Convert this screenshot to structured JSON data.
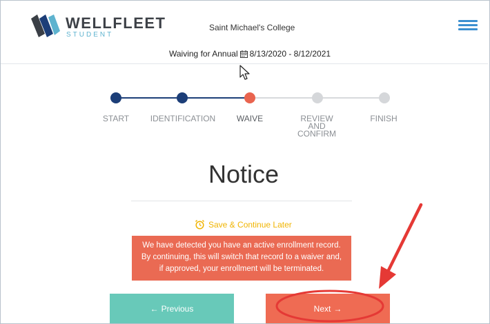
{
  "header": {
    "logo_word": "WELLFLEET",
    "logo_sub": "STUDENT",
    "college": "Saint Michael's College",
    "waive_prefix": "Waiving for Annual",
    "date_range": "8/13/2020 - 8/12/2021",
    "menu_icon": "hamburger-menu-icon"
  },
  "steps": [
    {
      "label": "START",
      "state": "done"
    },
    {
      "label": "IDENTIFICATION",
      "state": "done"
    },
    {
      "label": "WAIVE",
      "state": "active"
    },
    {
      "label_lines": [
        "REVIEW",
        "AND",
        "CONFIRM"
      ],
      "state": "todo"
    },
    {
      "label": "FINISH",
      "state": "todo"
    }
  ],
  "main": {
    "title": "Notice",
    "save_later": "Save & Continue Later",
    "notice_lines": [
      "We have detected you have an active enrollment record.",
      "By continuing, this will switch that record to a waiver and,",
      "if approved, your enrollment will be terminated."
    ]
  },
  "buttons": {
    "previous": "Previous",
    "next": "Next"
  },
  "colors": {
    "navy": "#1c3e78",
    "coral": "#ea6a53",
    "teal": "#68c9b9",
    "gold": "#f0b400",
    "annotation_red": "#e53935"
  }
}
